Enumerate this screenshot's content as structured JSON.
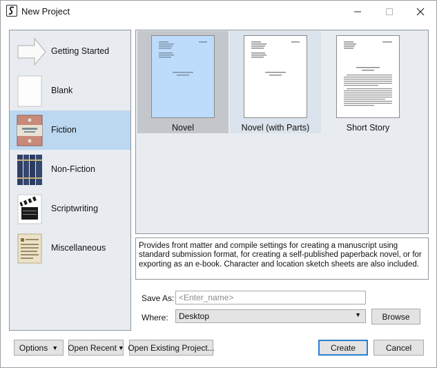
{
  "window": {
    "title": "New Project"
  },
  "categories": [
    {
      "label": "Getting Started",
      "icon": "arrow-icon"
    },
    {
      "label": "Blank",
      "icon": "blank-page-icon"
    },
    {
      "label": "Fiction",
      "icon": "book-cover-icon",
      "selected": true
    },
    {
      "label": "Non-Fiction",
      "icon": "book-spines-icon"
    },
    {
      "label": "Scriptwriting",
      "icon": "clapperboard-icon"
    },
    {
      "label": "Miscellaneous",
      "icon": "parchment-icon"
    }
  ],
  "templates": [
    {
      "label": "Novel",
      "selected": true
    },
    {
      "label": "Novel (with Parts)"
    },
    {
      "label": "Short Story"
    }
  ],
  "description": "Provides front matter and compile settings for creating a manuscript using standard submission format, for creating a self-published paperback novel, or for exporting as an e-book. Character and location sketch sheets are also included.",
  "form": {
    "save_as_label": "Save As:",
    "save_as_placeholder": "<Enter_name>",
    "save_as_value": "",
    "where_label": "Where:",
    "where_value": "Desktop",
    "browse_label": "Browse"
  },
  "footer": {
    "options_label": "Options",
    "open_recent_label": "Open Recent",
    "open_existing_label": "Open Existing Project...",
    "create_label": "Create",
    "cancel_label": "Cancel"
  },
  "colors": {
    "selection": "#bcd7f0",
    "panel_bg": "#e8ecf1",
    "primary_border": "#2b7fd1"
  }
}
